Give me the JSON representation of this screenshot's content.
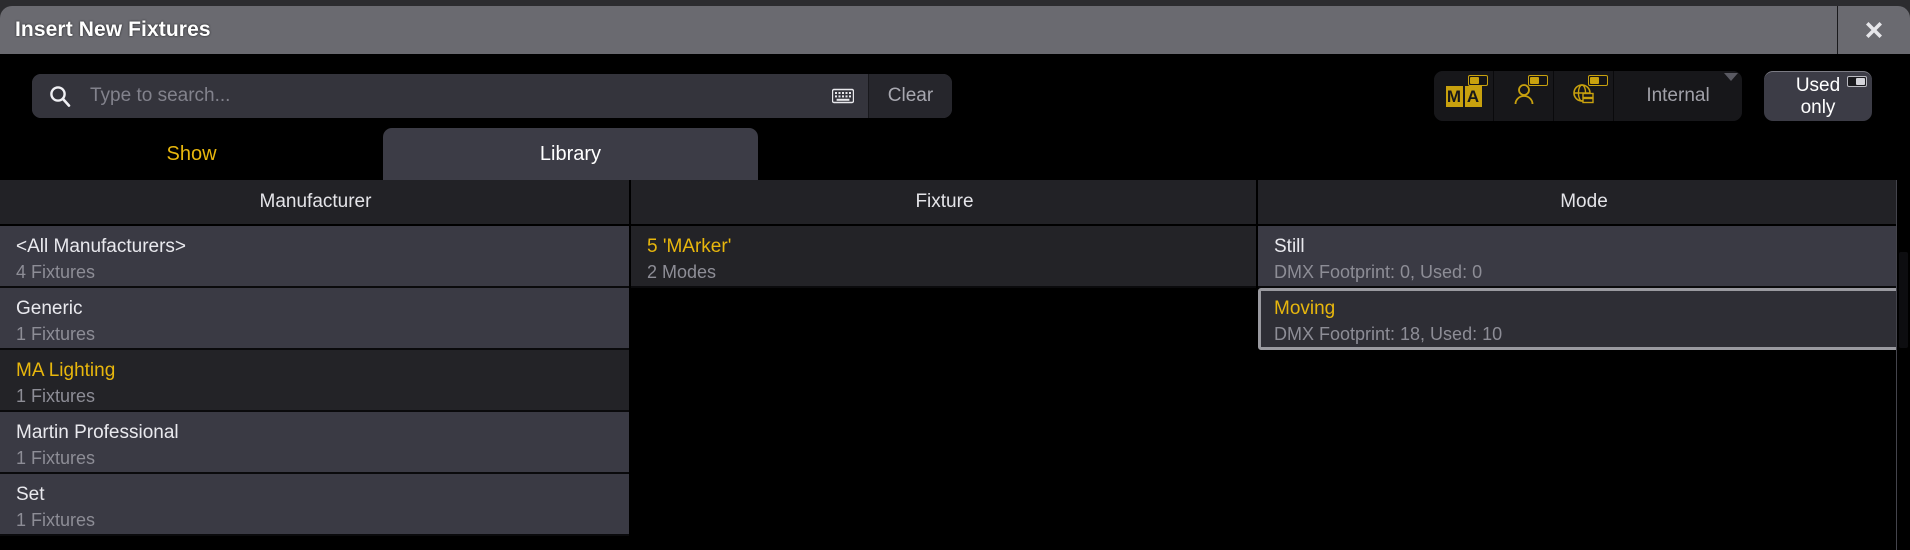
{
  "window": {
    "title": "Insert New Fixtures",
    "close_icon": "close-icon"
  },
  "search": {
    "placeholder": "Type to search...",
    "value": "",
    "search_icon": "search-icon",
    "keyboard_icon": "keyboard-icon",
    "clear_label": "Clear"
  },
  "filters": {
    "ma_label_1": "M",
    "ma_label_2": "A",
    "ma_icon": "ma-logo-icon",
    "user_icon": "user-icon",
    "globe_icon": "globe-server-icon",
    "internal_label": "Internal",
    "used_only_label_line1": "Used",
    "used_only_label_line2": "only"
  },
  "tabs": [
    {
      "label": "Show",
      "active": false
    },
    {
      "label": "Library",
      "active": true
    }
  ],
  "columns": {
    "manufacturer_header": "Manufacturer",
    "fixture_header": "Fixture",
    "mode_header": "Mode"
  },
  "manufacturers": [
    {
      "name": "<All Manufacturers>",
      "sub": "4 Fixtures",
      "selected": false
    },
    {
      "name": "Generic",
      "sub": "1 Fixtures",
      "selected": false
    },
    {
      "name": "MA Lighting",
      "sub": "1 Fixtures",
      "selected": true
    },
    {
      "name": "Martin Professional",
      "sub": "1 Fixtures",
      "selected": false
    },
    {
      "name": "Set",
      "sub": "1 Fixtures",
      "selected": false
    }
  ],
  "fixtures": [
    {
      "name": "5 'MArker'",
      "sub": "2 Modes",
      "selected": true
    }
  ],
  "modes": [
    {
      "name": "Still",
      "sub": "DMX Footprint: 0, Used: 0",
      "selected": false,
      "boxed": false
    },
    {
      "name": "Moving",
      "sub": "DMX Footprint: 18, Used: 10",
      "selected": true,
      "boxed": true
    }
  ],
  "colors": {
    "accent_yellow": "#e8b70d",
    "titlebar_gray": "#6a6a70",
    "row_bg": "#3a3a44",
    "row_selected_bg": "#232327",
    "header_bg": "#222226",
    "panel_bg": "#000000",
    "selection_border": "#9a9aa0"
  }
}
